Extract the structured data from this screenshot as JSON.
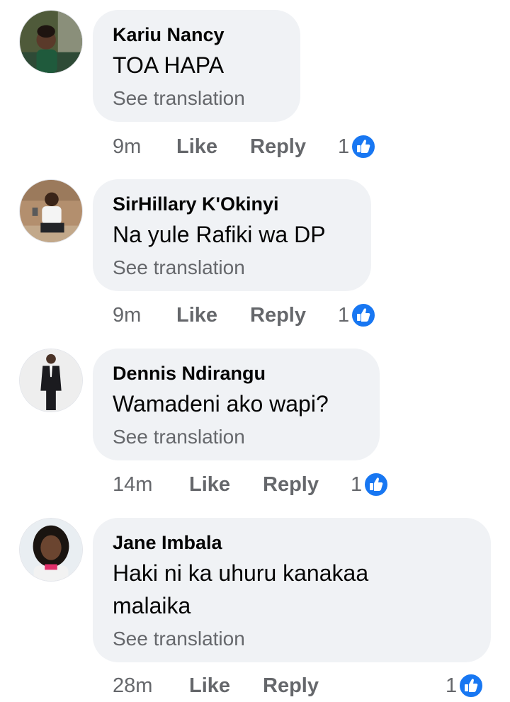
{
  "comments": [
    {
      "author": "Kariu Nancy",
      "text": "TOA HAPA",
      "see_translation": "See translation",
      "time": "9m",
      "like_label": "Like",
      "reply_label": "Reply",
      "reaction_count": "1",
      "reaction_icon": "like-icon"
    },
    {
      "author": "SirHillary K'Okinyi",
      "text": "Na yule Rafiki wa DP",
      "see_translation": "See translation",
      "time": "9m",
      "like_label": "Like",
      "reply_label": "Reply",
      "reaction_count": "1",
      "reaction_icon": "like-icon"
    },
    {
      "author": "Dennis Ndirangu",
      "text": "Wamadeni ako wapi?",
      "see_translation": "See translation",
      "time": "14m",
      "like_label": "Like",
      "reply_label": "Reply",
      "reaction_count": "1",
      "reaction_icon": "like-icon"
    },
    {
      "author": "Jane Imbala",
      "text": "Haki ni ka uhuru kanakaa malaika",
      "see_translation": "See translation",
      "time": "28m",
      "like_label": "Like",
      "reply_label": "Reply",
      "reaction_count": "1",
      "reaction_icon": "like-icon"
    }
  ],
  "colors": {
    "bubble_background": "#f0f2f5",
    "secondary_text": "#65676b",
    "primary_text": "#050505",
    "like_blue": "#1877f2"
  }
}
